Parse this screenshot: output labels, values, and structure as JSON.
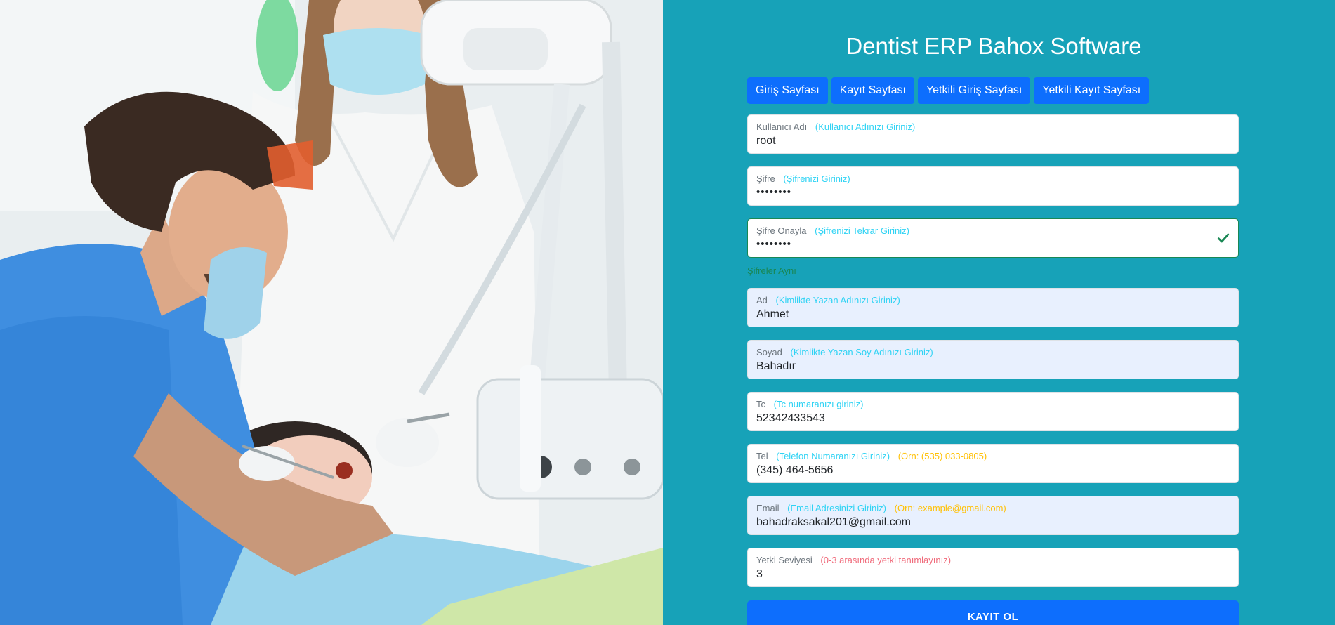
{
  "app": {
    "title": "Dentist ERP Bahox Software"
  },
  "tabs": [
    {
      "label": "Giriş Sayfası"
    },
    {
      "label": "Kayıt Sayfası"
    },
    {
      "label": "Yetkili Giriş Sayfası"
    },
    {
      "label": "Yetkili Kayıt Sayfası"
    }
  ],
  "form": {
    "username": {
      "label": "Kullanıcı Adı",
      "hint": "(Kullanıcı Adınızı Giriniz)",
      "value": "root"
    },
    "password": {
      "label": "Şifre",
      "hint": "(Şifrenizi Giriniz)",
      "value": "••••••••"
    },
    "password_confirm": {
      "label": "Şifre Onayla",
      "hint": "(Şifrenizi Tekrar Giriniz)",
      "value": "••••••••",
      "valid_message": "Şifreler Aynı"
    },
    "first_name": {
      "label": "Ad",
      "hint": "(Kimlikte Yazan Adınızı Giriniz)",
      "value": "Ahmet"
    },
    "last_name": {
      "label": "Soyad",
      "hint": "(Kimlikte Yazan Soy Adınızı Giriniz)",
      "value": "Bahadır"
    },
    "tc": {
      "label": "Tc",
      "hint": "(Tc numaranızı giriniz)",
      "value": "52342433543"
    },
    "phone": {
      "label": "Tel",
      "hint": "(Telefon Numaranızı Giriniz)",
      "example": "(Örn: (535) 033-0805)",
      "value": "(345) 464-5656"
    },
    "email": {
      "label": "Email",
      "hint": "(Email Adresinizi Giriniz)",
      "example": "(Örn: example@gmail.com)",
      "value": "bahadraksakal201@gmail.com"
    },
    "auth_level": {
      "label": "Yetki Seviyesi",
      "hint": "(0-3 arasında yetki tanımlayınız)",
      "value": "3"
    },
    "submit_label": "KAYIT OL"
  },
  "colors": {
    "panel_bg": "#17a2b8",
    "button_blue": "#0d6efd",
    "hint_blue": "#2fd3f4",
    "hint_yellow": "#ffc107",
    "hint_red": "#f06b7b",
    "valid_green": "#198754"
  },
  "icons": {
    "confirm_valid": "check-icon"
  }
}
